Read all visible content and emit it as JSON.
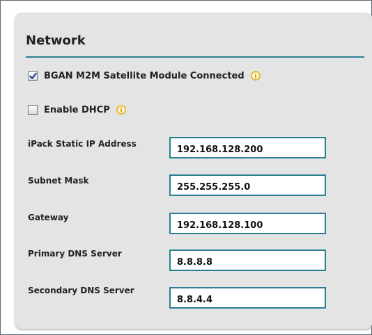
{
  "panel": {
    "title": "Network"
  },
  "checks": [
    {
      "label": "BGAN M2M Satellite Module Connected",
      "checked": true,
      "has_info": true
    },
    {
      "label": "Enable DHCP",
      "checked": false,
      "has_info": true
    }
  ],
  "fields": [
    {
      "label": "iPack Static IP Address",
      "value": "192.168.128.200"
    },
    {
      "label": "Subnet Mask",
      "value": "255.255.255.0"
    },
    {
      "label": "Gateway",
      "value": "192.168.128.100"
    },
    {
      "label": "Primary DNS Server",
      "value": "8.8.8.8"
    },
    {
      "label": "Secondary DNS Server",
      "value": "8.8.4.4"
    }
  ],
  "colors": {
    "accent": "#2b7f93",
    "info_icon": "#e0a800",
    "checkmark": "#1f3f99",
    "panel_bg": "#e4e4e4"
  },
  "icons": {
    "info": "info-icon",
    "check": "checkmark-icon"
  }
}
